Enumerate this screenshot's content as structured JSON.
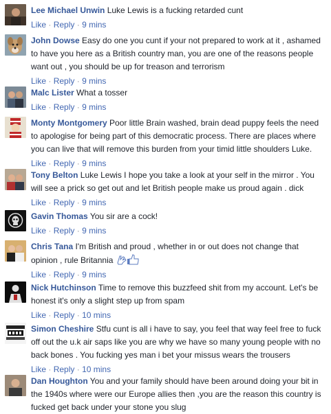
{
  "actions": {
    "like": "Like",
    "reply": "Reply",
    "sep": "·"
  },
  "comments": [
    {
      "name": "Lee Michael Unwin",
      "text": "Luke Lewis is a fucking retarded cunt",
      "time": "9 mins",
      "avatar": "person-photo-avatar"
    },
    {
      "name": "John Dowse",
      "text": "Easy do one you cunt if your not prepared to work at it , ashamed to have you here as a British country man, you are one of the reasons people want out , you should be up for treason and terrorism",
      "time": "9 mins",
      "avatar": "dog-photo-avatar"
    },
    {
      "name": "Malc Lister",
      "text": "What a tosser",
      "time": "9 mins",
      "avatar": "couple-photo-avatar"
    },
    {
      "name": "Monty Montgomery",
      "text": "Poor little Brain washed, brain dead puppy feels the need to apologise for being part of this democratic process. There are places where you can live that will remove this burden from your timid little shoulders Luke.",
      "time": "9 mins",
      "avatar": "cartoon-character-avatar"
    },
    {
      "name": "Tony Belton",
      "text": "Luke Lewis I hope you take a look at your self in the mirror . You will see a prick so get out and let British people make us proud again . dick",
      "time": "9 mins",
      "avatar": "couple-photo-avatar"
    },
    {
      "name": "Gavin Thomas",
      "text": "You sir are a cock!",
      "time": "9 mins",
      "avatar": "skull-emblem-avatar"
    },
    {
      "name": "Chris Tana",
      "text": "I'm British and proud , whether in or out does not change that opinion , rule Britannia",
      "time": "9 mins",
      "avatar": "couple-photo-avatar",
      "emoji": "clapping-thumbs-up-emoji"
    },
    {
      "name": "Nick Hutchinson",
      "text": "Time to remove this buzzfeed shit from my account. Let's be honest it's only a slight step up from spam",
      "time": "10 mins",
      "avatar": "dark-figure-avatar"
    },
    {
      "name": "Simon Cheshire",
      "text": "Stfu cunt is all i have to say, you feel that way feel free to fuck off out the u.k air saps like you are why we have so many young people with no back bones . You fucking yes man i bet your missus wears the trousers",
      "time": "10 mins",
      "avatar": "text-logo-avatar"
    },
    {
      "name": "Dan Houghton",
      "text": "You and your family should have been around doing your bit in the 1940s where were our Europe allies then ,you are the reason this country is fucked get back under your stone you slug",
      "time": "",
      "avatar": "person-photo-avatar"
    }
  ]
}
